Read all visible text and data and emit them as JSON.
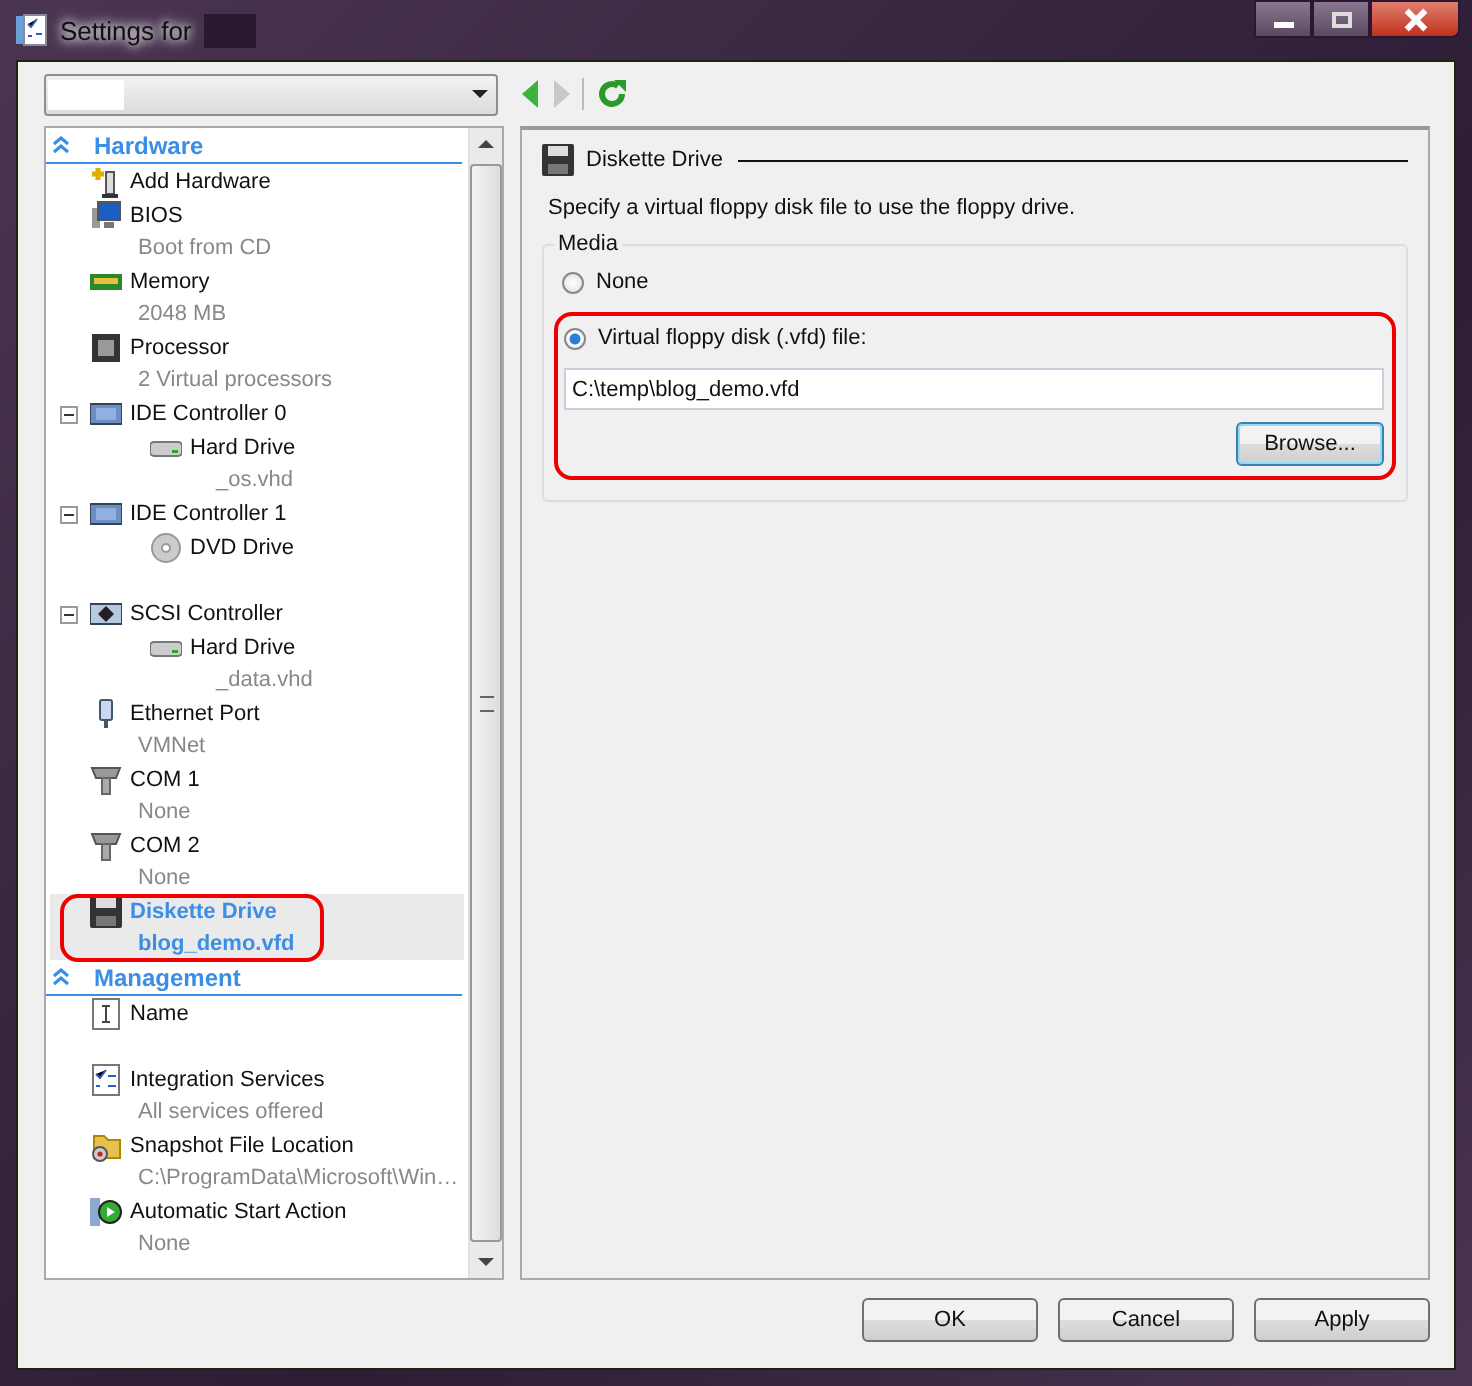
{
  "window": {
    "title": "Settings for"
  },
  "navigation": {
    "back_enabled": true,
    "forward_enabled": false
  },
  "tree": {
    "sections": [
      {
        "title": "Hardware",
        "expanded": true,
        "items": [
          {
            "kind": "add",
            "label": "Add Hardware",
            "selected": false,
            "circled": false
          },
          {
            "kind": "bios",
            "label": "BIOS",
            "detail": "Boot from CD",
            "selected": false,
            "circled": false
          },
          {
            "kind": "memory",
            "label": "Memory",
            "detail": "2048 MB",
            "selected": false,
            "circled": false
          },
          {
            "kind": "processor",
            "label": "Processor",
            "detail": "2 Virtual processors",
            "selected": false,
            "circled": false
          },
          {
            "kind": "controller",
            "label": "IDE Controller 0",
            "expanded": true,
            "selected": false,
            "circled": false,
            "children": [
              {
                "kind": "disk",
                "label": "Hard Drive",
                "detail": "_os.vhd",
                "selected": false,
                "circled": false
              }
            ]
          },
          {
            "kind": "controller",
            "label": "IDE Controller 1",
            "expanded": true,
            "selected": false,
            "circled": false,
            "children": [
              {
                "kind": "dvd",
                "label": "DVD Drive",
                "selected": false,
                "circled": false
              }
            ]
          },
          {
            "kind": "scsi",
            "label": "SCSI Controller",
            "expanded": true,
            "selected": false,
            "circled": false,
            "children": [
              {
                "kind": "disk",
                "label": "Hard Drive",
                "detail": "_data.vhd",
                "selected": false,
                "circled": false
              }
            ]
          },
          {
            "kind": "ethernet",
            "label": "Ethernet Port",
            "detail": "VMNet",
            "selected": false,
            "circled": false
          },
          {
            "kind": "com",
            "label": "COM 1",
            "detail": "None",
            "selected": false,
            "circled": false
          },
          {
            "kind": "com",
            "label": "COM 2",
            "detail": "None",
            "selected": false,
            "circled": false
          },
          {
            "kind": "floppy",
            "label": "Diskette Drive",
            "detail": "blog_demo.vfd",
            "selected": true,
            "circled": true
          }
        ]
      },
      {
        "title": "Management",
        "expanded": true,
        "items": [
          {
            "kind": "name",
            "label": "Name",
            "selected": false,
            "circled": false
          },
          {
            "kind": "checklist",
            "label": "Integration Services",
            "detail": "All services offered",
            "selected": false,
            "circled": false
          },
          {
            "kind": "folder",
            "label": "Snapshot File Location",
            "detail": "C:\\ProgramData\\Microsoft\\Win…",
            "selected": false,
            "circled": false
          },
          {
            "kind": "autostart",
            "label": "Automatic Start Action",
            "detail": "None",
            "selected": false,
            "circled": false
          }
        ]
      }
    ]
  },
  "panel": {
    "title": "Diskette Drive",
    "description": "Specify a virtual floppy disk file to use the floppy drive.",
    "group": "Media",
    "options": [
      {
        "label": "None",
        "selected": false,
        "circled": false
      },
      {
        "label": "Virtual floppy disk (.vfd) file:",
        "selected": true,
        "circled": true,
        "path": "C:\\temp\\blog_demo.vfd",
        "button": "Browse..."
      }
    ]
  },
  "buttons": [
    "OK",
    "Cancel",
    "Apply"
  ]
}
